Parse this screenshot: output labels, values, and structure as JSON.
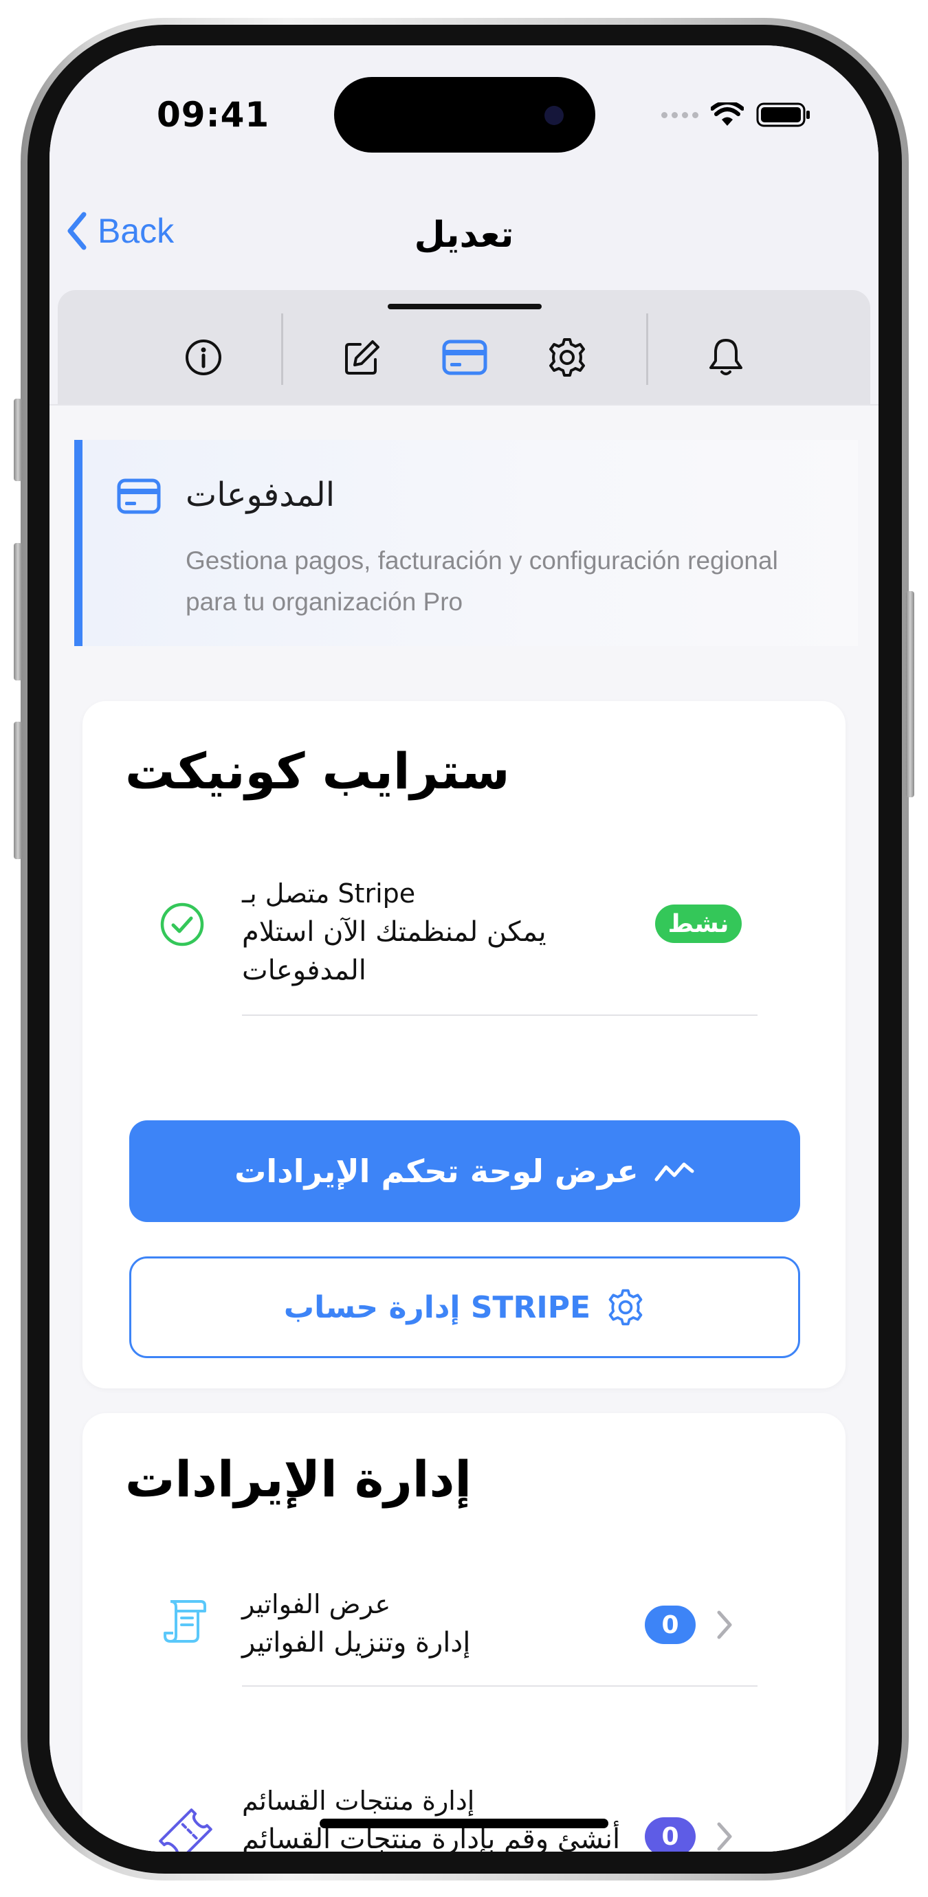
{
  "status_bar": {
    "time": "09:41"
  },
  "nav": {
    "back_label": "Back",
    "title": "تعديل"
  },
  "tabs": [
    {
      "icon": "info-icon",
      "active": false
    },
    {
      "icon": "edit-icon",
      "active": false
    },
    {
      "icon": "credit-card-icon",
      "active": true
    },
    {
      "icon": "gear-icon",
      "active": false
    },
    {
      "icon": "bell-icon",
      "active": false
    }
  ],
  "section_header": {
    "icon": "credit-card-icon",
    "title": "المدفوعات",
    "description": "Gestiona pagos, facturación y configuración regional para tu organización Pro"
  },
  "stripe_card": {
    "title": "سترايب كونيكت",
    "status_row": {
      "icon": "check-circle-icon",
      "label": "متصل بـ Stripe",
      "subtitle": "يمكن لمنظمتك الآن استلام المدفوعات",
      "badge": "نشط"
    },
    "primary_button": "عرض لوحة تحكم الإيرادات",
    "secondary_button": "إدارة حساب STRIPE"
  },
  "revenue_card": {
    "title": "إدارة الإيرادات",
    "items": [
      {
        "icon": "receipt-icon",
        "label": "عرض الفواتير",
        "subtitle": "إدارة وتنزيل الفواتير",
        "count": "0"
      },
      {
        "icon": "ticket-icon",
        "label": "إدارة منتجات القسائم",
        "subtitle": "أنشئ وقم بإدارة منتجات القسائم لمؤسستك",
        "count": "0"
      }
    ]
  },
  "colors": {
    "accent": "#3d84f7",
    "success": "#34c759",
    "badge_indigo": "#5e5ce6",
    "receipt_icon": "#5ac8fa",
    "ticket_icon": "#5e5ce6"
  }
}
